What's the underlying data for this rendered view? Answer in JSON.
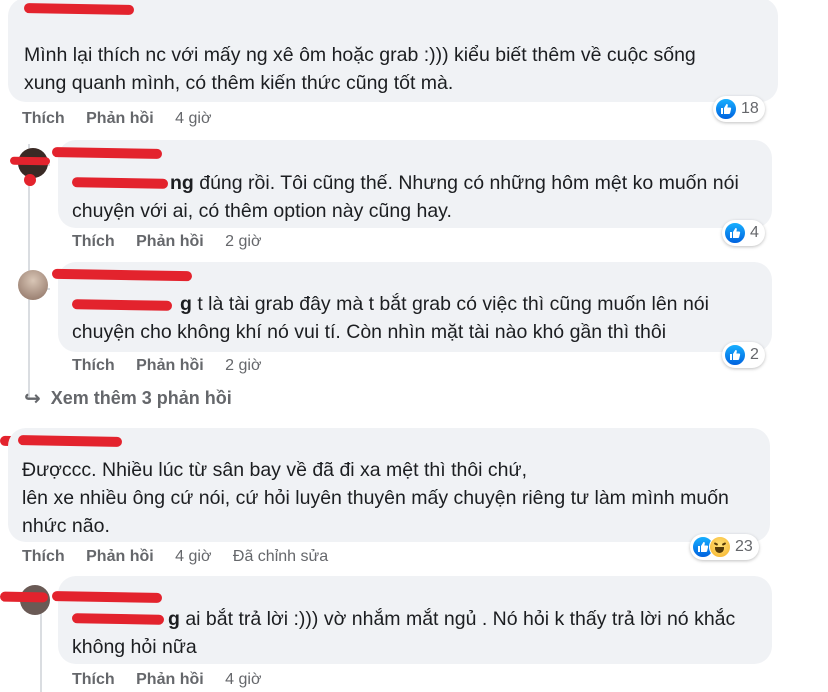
{
  "comments": [
    {
      "text": "Mình lại thích nc với mấy ng xê ôm hoặc grab :))) kiểu biết thêm về cuộc sống xung quanh mình, có thêm kiến thức cũng tốt mà.",
      "line1": "Mình lại thích nc với mấy ng xê ôm hoặc grab :))) kiểu biết thêm về cuộc sống",
      "line2": "xung quanh mình, có thêm kiến thức cũng tốt mà.",
      "like": "Thích",
      "reply": "Phản hồi",
      "time": "4 giờ",
      "reactions": {
        "icons": [
          "like-icon"
        ],
        "count": "18"
      }
    },
    {
      "mention_tail": "ng",
      "line1": " đúng rồi. Tôi cũng thế. Nhưng có những hôm mệt ko muốn nói",
      "line2": "chuyện với ai, có thêm option này cũng hay.",
      "like": "Thích",
      "reply": "Phản hồi",
      "time": "2 giờ",
      "reactions": {
        "icons": [
          "like-icon"
        ],
        "count": "4"
      }
    },
    {
      "mention_tail": "g",
      "line1": " t là tài grab đây mà t bắt grab có việc thì cũng muốn lên nói",
      "line2": "chuyện cho không khí nó vui tí. Còn nhìn mặt tài nào khó gần thì thôi",
      "like": "Thích",
      "reply": "Phản hồi",
      "time": "2 giờ",
      "reactions": {
        "icons": [
          "like-icon"
        ],
        "count": "2"
      }
    },
    {
      "line1": "Đượccc. Nhiều lúc từ sân bay về đã đi xa mệt thì thôi chứ,",
      "line2": "lên xe nhiều ông cứ nói, cứ hỏi luyên thuyên mấy chuyện riêng tư làm mình muốn",
      "line3": "nhức não.",
      "like": "Thích",
      "reply": "Phản hồi",
      "time": "4 giờ",
      "edited": "Đã chỉnh sửa",
      "reactions": {
        "icons": [
          "like-icon",
          "haha-icon"
        ],
        "count": "23"
      }
    },
    {
      "mention_tail": "g",
      "line1": " ai bắt trả lời :))) vờ nhắm mắt ngủ . Nó hỏi k thấy trả lời nó khắc",
      "line2": "không hỏi nữa",
      "like": "Thích",
      "reply": "Phản hồi",
      "time": "4 giờ"
    }
  ],
  "view_more": "Xem thêm 3 phản hồi",
  "colors": {
    "bubble": "#f0f2f5",
    "link_gray": "#65676b",
    "like_blue": "#1877f2",
    "redaction": "#e3232d"
  }
}
